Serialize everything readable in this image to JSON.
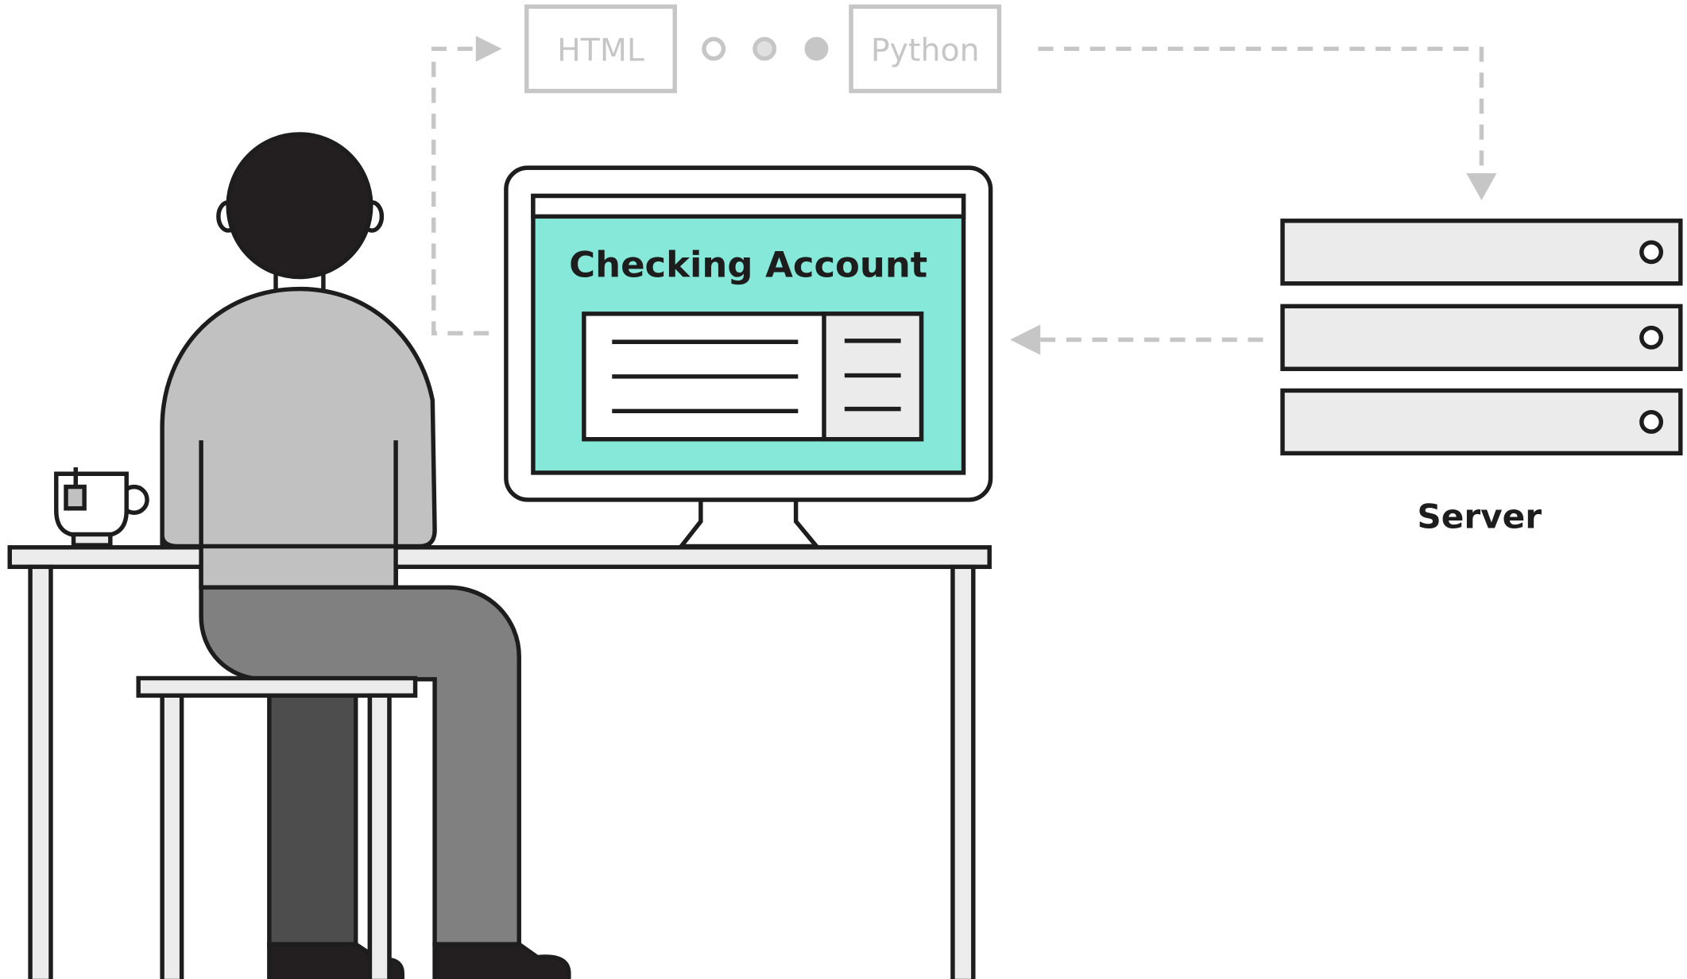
{
  "pipeline": {
    "steps": [
      "HTML",
      "Python"
    ],
    "dots": 3,
    "color": "#c6c6c6"
  },
  "screen": {
    "title": "Checking Account",
    "bg_color": "#86e8d9"
  },
  "server": {
    "label": "Server",
    "units": 3,
    "color": "#ebebeb"
  },
  "colors": {
    "outline": "#1d1d1d",
    "shirt": "#c1c1c1",
    "pants": "#808080",
    "pants_back": "#4d4d4d",
    "hair": "#231f20",
    "furniture": "#ececec"
  }
}
